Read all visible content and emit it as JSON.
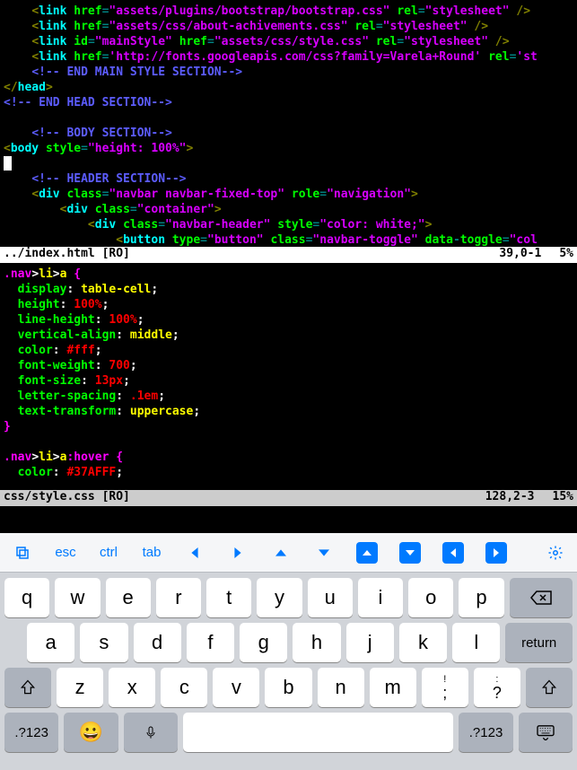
{
  "pane1": {
    "lines": [
      [
        {
          "c": "c-white",
          "t": "    "
        },
        {
          "c": "c-olive",
          "t": "<"
        },
        {
          "c": "c-cyan",
          "t": "link"
        },
        {
          "c": "c-white",
          "t": " "
        },
        {
          "c": "c-green",
          "t": "href"
        },
        {
          "c": "c-teal",
          "t": "="
        },
        {
          "c": "c-purple",
          "t": "\"assets/plugins/bootstrap/bootstrap.css\""
        },
        {
          "c": "c-white",
          "t": " "
        },
        {
          "c": "c-green",
          "t": "rel"
        },
        {
          "c": "c-teal",
          "t": "="
        },
        {
          "c": "c-purple",
          "t": "\"stylesheet\""
        },
        {
          "c": "c-white",
          "t": " "
        },
        {
          "c": "c-olive",
          "t": "/>"
        }
      ],
      [
        {
          "c": "c-white",
          "t": "    "
        },
        {
          "c": "c-olive",
          "t": "<"
        },
        {
          "c": "c-cyan",
          "t": "link"
        },
        {
          "c": "c-white",
          "t": " "
        },
        {
          "c": "c-green",
          "t": "href"
        },
        {
          "c": "c-teal",
          "t": "="
        },
        {
          "c": "c-purple",
          "t": "\"assets/css/about-achivements.css\""
        },
        {
          "c": "c-white",
          "t": " "
        },
        {
          "c": "c-green",
          "t": "rel"
        },
        {
          "c": "c-teal",
          "t": "="
        },
        {
          "c": "c-purple",
          "t": "\"stylesheet\""
        },
        {
          "c": "c-white",
          "t": " "
        },
        {
          "c": "c-olive",
          "t": "/>"
        }
      ],
      [
        {
          "c": "c-white",
          "t": "    "
        },
        {
          "c": "c-olive",
          "t": "<"
        },
        {
          "c": "c-cyan",
          "t": "link"
        },
        {
          "c": "c-white",
          "t": " "
        },
        {
          "c": "c-green",
          "t": "id"
        },
        {
          "c": "c-teal",
          "t": "="
        },
        {
          "c": "c-purple",
          "t": "\"mainStyle\""
        },
        {
          "c": "c-white",
          "t": " "
        },
        {
          "c": "c-green",
          "t": "href"
        },
        {
          "c": "c-teal",
          "t": "="
        },
        {
          "c": "c-purple",
          "t": "\"assets/css/style.css\""
        },
        {
          "c": "c-white",
          "t": " "
        },
        {
          "c": "c-green",
          "t": "rel"
        },
        {
          "c": "c-teal",
          "t": "="
        },
        {
          "c": "c-purple",
          "t": "\"stylesheet\""
        },
        {
          "c": "c-white",
          "t": " "
        },
        {
          "c": "c-olive",
          "t": "/>"
        }
      ],
      [
        {
          "c": "c-white",
          "t": "    "
        },
        {
          "c": "c-olive",
          "t": "<"
        },
        {
          "c": "c-cyan",
          "t": "link"
        },
        {
          "c": "c-white",
          "t": " "
        },
        {
          "c": "c-green",
          "t": "href"
        },
        {
          "c": "c-teal",
          "t": "="
        },
        {
          "c": "c-purple",
          "t": "'http://fonts.googleapis.com/css?family=Varela+Round'"
        },
        {
          "c": "c-white",
          "t": " "
        },
        {
          "c": "c-green",
          "t": "rel"
        },
        {
          "c": "c-teal",
          "t": "="
        },
        {
          "c": "c-purple",
          "t": "'st"
        }
      ],
      [
        {
          "c": "c-white",
          "t": "    "
        },
        {
          "c": "c-blue",
          "t": "<!-- END MAIN STYLE SECTION-->"
        }
      ],
      [
        {
          "c": "c-olive",
          "t": "</"
        },
        {
          "c": "c-cyan",
          "t": "head"
        },
        {
          "c": "c-olive",
          "t": ">"
        }
      ],
      [
        {
          "c": "c-blue",
          "t": "<!-- END HEAD SECTION-->"
        }
      ],
      [
        {
          "c": "c-white",
          "t": " "
        }
      ],
      [
        {
          "c": "c-white",
          "t": "    "
        },
        {
          "c": "c-blue",
          "t": "<!-- BODY SECTION-->"
        }
      ],
      [
        {
          "c": "c-olive",
          "t": "<"
        },
        {
          "c": "c-cyan",
          "t": "body"
        },
        {
          "c": "c-white",
          "t": " "
        },
        {
          "c": "c-green",
          "t": "style"
        },
        {
          "c": "c-teal",
          "t": "="
        },
        {
          "c": "c-purple",
          "t": "\"height: 100%\""
        },
        {
          "c": "c-olive",
          "t": ">"
        }
      ],
      [
        {
          "c": "cursor",
          "t": " "
        }
      ],
      [
        {
          "c": "c-white",
          "t": "    "
        },
        {
          "c": "c-blue",
          "t": "<!-- HEADER SECTION-->"
        }
      ],
      [
        {
          "c": "c-white",
          "t": "    "
        },
        {
          "c": "c-olive",
          "t": "<"
        },
        {
          "c": "c-cyan",
          "t": "div"
        },
        {
          "c": "c-white",
          "t": " "
        },
        {
          "c": "c-green",
          "t": "class"
        },
        {
          "c": "c-teal",
          "t": "="
        },
        {
          "c": "c-purple",
          "t": "\"navbar navbar-fixed-top\""
        },
        {
          "c": "c-white",
          "t": " "
        },
        {
          "c": "c-green",
          "t": "role"
        },
        {
          "c": "c-teal",
          "t": "="
        },
        {
          "c": "c-purple",
          "t": "\"navigation\""
        },
        {
          "c": "c-olive",
          "t": ">"
        }
      ],
      [
        {
          "c": "c-white",
          "t": "        "
        },
        {
          "c": "c-olive",
          "t": "<"
        },
        {
          "c": "c-cyan",
          "t": "div"
        },
        {
          "c": "c-white",
          "t": " "
        },
        {
          "c": "c-green",
          "t": "class"
        },
        {
          "c": "c-teal",
          "t": "="
        },
        {
          "c": "c-purple",
          "t": "\"container\""
        },
        {
          "c": "c-olive",
          "t": ">"
        }
      ],
      [
        {
          "c": "c-white",
          "t": "            "
        },
        {
          "c": "c-olive",
          "t": "<"
        },
        {
          "c": "c-cyan",
          "t": "div"
        },
        {
          "c": "c-white",
          "t": " "
        },
        {
          "c": "c-green",
          "t": "class"
        },
        {
          "c": "c-teal",
          "t": "="
        },
        {
          "c": "c-purple",
          "t": "\"navbar-header\""
        },
        {
          "c": "c-white",
          "t": " "
        },
        {
          "c": "c-green",
          "t": "style"
        },
        {
          "c": "c-teal",
          "t": "="
        },
        {
          "c": "c-purple",
          "t": "\"color: white;\""
        },
        {
          "c": "c-olive",
          "t": ">"
        }
      ],
      [
        {
          "c": "c-white",
          "t": "                "
        },
        {
          "c": "c-olive",
          "t": "<"
        },
        {
          "c": "c-cyan",
          "t": "button"
        },
        {
          "c": "c-white",
          "t": " "
        },
        {
          "c": "c-green",
          "t": "type"
        },
        {
          "c": "c-teal",
          "t": "="
        },
        {
          "c": "c-purple",
          "t": "\"button\""
        },
        {
          "c": "c-white",
          "t": " "
        },
        {
          "c": "c-green",
          "t": "class"
        },
        {
          "c": "c-teal",
          "t": "="
        },
        {
          "c": "c-purple",
          "t": "\"navbar-toggle\""
        },
        {
          "c": "c-white",
          "t": " "
        },
        {
          "c": "c-green",
          "t": "data"
        },
        {
          "c": "c-teal",
          "t": "-"
        },
        {
          "c": "c-green",
          "t": "toggle"
        },
        {
          "c": "c-teal",
          "t": "="
        },
        {
          "c": "c-purple",
          "t": "\"col"
        }
      ]
    ]
  },
  "status1": {
    "file": "../index.html [RO]",
    "pos": "39,0-1",
    "pct": "5%"
  },
  "pane2": {
    "lines": [
      [
        {
          "c": "c-magenta",
          "t": ".nav"
        },
        {
          "c": "c-white",
          "t": ">"
        },
        {
          "c": "c-yellow",
          "t": "li"
        },
        {
          "c": "c-white",
          "t": ">"
        },
        {
          "c": "c-yellow",
          "t": "a"
        },
        {
          "c": "c-white",
          "t": " "
        },
        {
          "c": "c-magenta",
          "t": "{"
        }
      ],
      [
        {
          "c": "c-white",
          "t": "  "
        },
        {
          "c": "c-green",
          "t": "display"
        },
        {
          "c": "c-white",
          "t": ": "
        },
        {
          "c": "c-yellow",
          "t": "table-cell"
        },
        {
          "c": "c-white",
          "t": ";"
        }
      ],
      [
        {
          "c": "c-white",
          "t": "  "
        },
        {
          "c": "c-green",
          "t": "height"
        },
        {
          "c": "c-white",
          "t": ": "
        },
        {
          "c": "c-red",
          "t": "100%"
        },
        {
          "c": "c-white",
          "t": ";"
        }
      ],
      [
        {
          "c": "c-white",
          "t": "  "
        },
        {
          "c": "c-green",
          "t": "line-height"
        },
        {
          "c": "c-white",
          "t": ": "
        },
        {
          "c": "c-red",
          "t": "100%"
        },
        {
          "c": "c-white",
          "t": ";"
        }
      ],
      [
        {
          "c": "c-white",
          "t": "  "
        },
        {
          "c": "c-green",
          "t": "vertical-align"
        },
        {
          "c": "c-white",
          "t": ": "
        },
        {
          "c": "c-yellow",
          "t": "middle"
        },
        {
          "c": "c-white",
          "t": ";"
        }
      ],
      [
        {
          "c": "c-white",
          "t": "  "
        },
        {
          "c": "c-green",
          "t": "color"
        },
        {
          "c": "c-white",
          "t": ": "
        },
        {
          "c": "c-red",
          "t": "#fff"
        },
        {
          "c": "c-white",
          "t": ";"
        }
      ],
      [
        {
          "c": "c-white",
          "t": "  "
        },
        {
          "c": "c-green",
          "t": "font-weight"
        },
        {
          "c": "c-white",
          "t": ": "
        },
        {
          "c": "c-red",
          "t": "700"
        },
        {
          "c": "c-white",
          "t": ";"
        }
      ],
      [
        {
          "c": "c-white",
          "t": "  "
        },
        {
          "c": "c-green",
          "t": "font-size"
        },
        {
          "c": "c-white",
          "t": ": "
        },
        {
          "c": "c-red",
          "t": "13px"
        },
        {
          "c": "c-white",
          "t": ";"
        }
      ],
      [
        {
          "c": "c-white",
          "t": "  "
        },
        {
          "c": "c-green",
          "t": "letter-spacing"
        },
        {
          "c": "c-white",
          "t": ": "
        },
        {
          "c": "c-red",
          "t": ".1em"
        },
        {
          "c": "c-white",
          "t": ";"
        }
      ],
      [
        {
          "c": "c-white",
          "t": "  "
        },
        {
          "c": "c-green",
          "t": "text-transform"
        },
        {
          "c": "c-white",
          "t": ": "
        },
        {
          "c": "c-yellow",
          "t": "uppercase"
        },
        {
          "c": "c-white",
          "t": ";"
        }
      ],
      [
        {
          "c": "c-magenta",
          "t": "}"
        }
      ],
      [
        {
          "c": "c-white",
          "t": " "
        }
      ],
      [
        {
          "c": "c-magenta",
          "t": ".nav"
        },
        {
          "c": "c-white",
          "t": ">"
        },
        {
          "c": "c-yellow",
          "t": "li"
        },
        {
          "c": "c-white",
          "t": ">"
        },
        {
          "c": "c-yellow",
          "t": "a"
        },
        {
          "c": "c-magenta",
          "t": ":hover"
        },
        {
          "c": "c-white",
          "t": " "
        },
        {
          "c": "c-magenta",
          "t": "{"
        }
      ],
      [
        {
          "c": "c-white",
          "t": "  "
        },
        {
          "c": "c-green",
          "t": "color"
        },
        {
          "c": "c-white",
          "t": ": "
        },
        {
          "c": "c-red",
          "t": "#37AFFF"
        },
        {
          "c": "c-white",
          "t": ";"
        }
      ]
    ]
  },
  "status2": {
    "file": "css/style.css [RO]",
    "pos": "128,2-3",
    "pct": "15%"
  },
  "kbar": {
    "esc": "esc",
    "ctrl": "ctrl",
    "tab": "tab"
  },
  "keys": {
    "row1": [
      "q",
      "w",
      "e",
      "r",
      "t",
      "y",
      "u",
      "i",
      "o",
      "p"
    ],
    "row2": [
      "a",
      "s",
      "d",
      "f",
      "g",
      "h",
      "j",
      "k",
      "l"
    ],
    "row3": [
      "z",
      "x",
      "c",
      "v",
      "b",
      "n",
      "m",
      ";",
      "?"
    ],
    "return": "return",
    "numkey": ".?123"
  }
}
